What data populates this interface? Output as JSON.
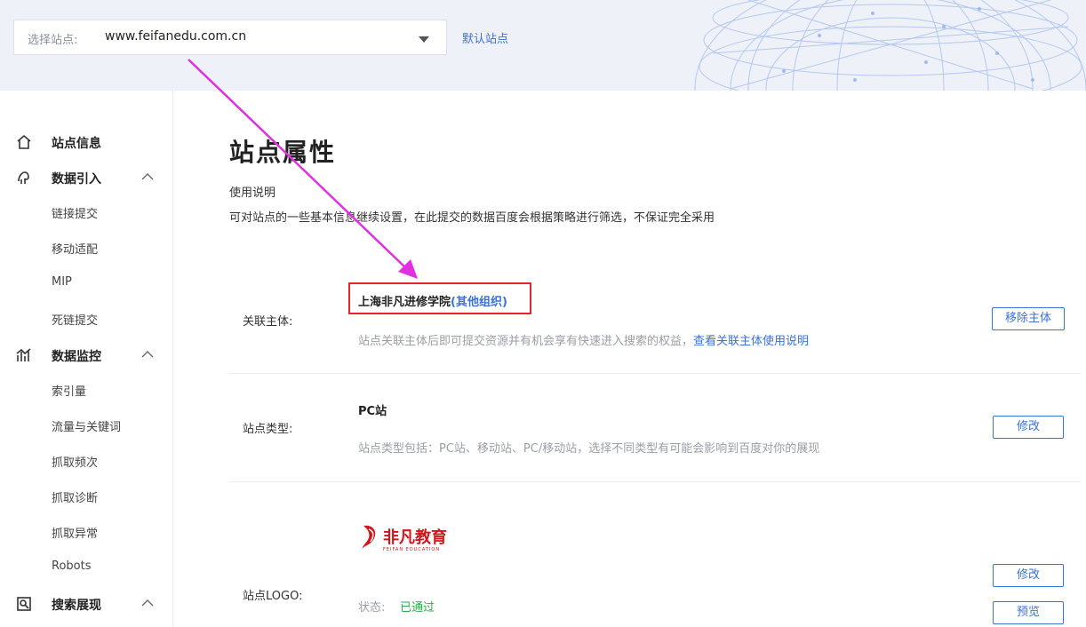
{
  "site_selector": {
    "label": "选择站点:",
    "value": "www.feifanedu.com.cn",
    "default_link": "默认站点"
  },
  "sidebar": {
    "groups": [
      {
        "label": "站点信息",
        "icon": "home-icon"
      },
      {
        "label": "数据引入",
        "icon": "data-import-icon",
        "items": [
          "链接提交",
          "移动适配",
          "MIP",
          "死链提交"
        ]
      },
      {
        "label": "数据监控",
        "icon": "chart-icon",
        "items": [
          "索引量",
          "流量与关键词",
          "抓取频次",
          "抓取诊断",
          "抓取异常",
          "Robots"
        ]
      },
      {
        "label": "搜索展现",
        "icon": "search-display-icon"
      }
    ]
  },
  "main": {
    "title": "站点属性",
    "usage_title": "使用说明",
    "usage_desc": "可对站点的一些基本信息继续设置，在此提交的数据百度会根据策略进行筛选，不保证完全采用",
    "entity": {
      "label": "关联主体:",
      "name": "上海非凡进修学院",
      "tag": "(其他组织)",
      "note": "站点关联主体后即可提交资源并有机会享有快速进入搜索的权益，",
      "note_link": "查看关联主体使用说明",
      "button": "移除主体"
    },
    "site_type": {
      "label": "站点类型:",
      "value": "PC站",
      "note": "站点类型包括：PC站、移动站、PC/移动站，选择不同类型有可能会影响到百度对你的展现",
      "button": "修改"
    },
    "logo": {
      "label": "站点LOGO:",
      "brand_text": "非凡教育",
      "brand_sub": "FEIFAN EDUCATION",
      "status_label": "状态:",
      "status_value": "已通过",
      "edit_button": "修改",
      "preview_button": "预览"
    }
  },
  "colors": {
    "accent": "#3a72d9",
    "highlight_box": "#e2262b",
    "annotation_arrow": "#e030e0",
    "status_ok": "#2fa84f"
  }
}
